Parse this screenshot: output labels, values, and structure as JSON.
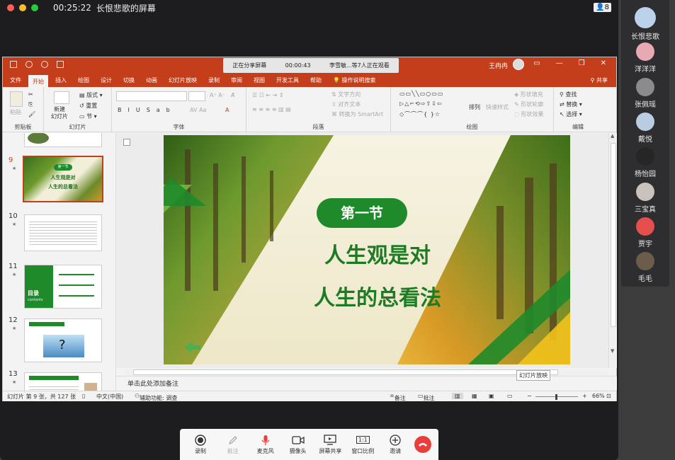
{
  "meeting": {
    "elapsed": "00:25:22",
    "window_title": "长恨悲歌的屏幕",
    "participant_count": "8"
  },
  "participants": [
    {
      "name": "长恨悲歌",
      "color": "#bcd2ea"
    },
    {
      "name": "洋洋洋",
      "color": "#e7a9b3"
    },
    {
      "name": "张佩瑶",
      "color": "#8b8a8c"
    },
    {
      "name": "戴悦",
      "color": "#b9cde2"
    },
    {
      "name": "杨怡园",
      "color": "#262626"
    },
    {
      "name": "三宝真",
      "color": "#c9c2bb"
    },
    {
      "name": "贾宇",
      "color": "#e44f4d"
    },
    {
      "name": "毛毛",
      "color": "#6b5c4c"
    }
  ],
  "share_banner": {
    "status": "正在分享屏幕",
    "timer": "00:00:43",
    "viewers": "李雪敏...等7人正在观看"
  },
  "ppt": {
    "user_name": "王冉冉",
    "share_label": "共享",
    "tabs": [
      "文件",
      "开始",
      "插入",
      "绘图",
      "设计",
      "切换",
      "动画",
      "幻灯片放映",
      "录制",
      "审阅",
      "视图",
      "开发工具",
      "帮助",
      "操作说明搜索"
    ],
    "active_tab": "开始",
    "ribbon": {
      "clipboard": {
        "label": "剪贴板",
        "paste": "粘贴"
      },
      "slides": {
        "label": "幻灯片",
        "new_slide": "新建\n幻灯片",
        "layout": "版式",
        "reset": "重置",
        "section": "节"
      },
      "font": {
        "label": "字体"
      },
      "paragraph": {
        "label": "段落",
        "text_direction": "文字方向",
        "align_text": "对齐文本",
        "smartart": "转换为 SmartArt"
      },
      "drawing": {
        "label": "绘图",
        "arrange": "排列",
        "quick_styles": "快速样式",
        "fill": "形状填充",
        "outline": "形状轮廓",
        "effects": "形状效果"
      },
      "editing": {
        "label": "编辑",
        "find": "查找",
        "replace": "替换",
        "select": "选择"
      }
    },
    "thumbnails": [
      {
        "num": "9",
        "selected": true,
        "title": "第一节",
        "line1": "人生观是对",
        "line2": "人生的总看法"
      },
      {
        "num": "10",
        "selected": false
      },
      {
        "num": "11",
        "selected": false,
        "label": "目录",
        "sub": "contents"
      },
      {
        "num": "12",
        "selected": false
      },
      {
        "num": "13",
        "selected": false
      }
    ],
    "slide": {
      "section": "第一节",
      "line1": "人生观是对",
      "line2": "人生的总看法"
    },
    "notes_placeholder": "单击此处添加备注",
    "slideshow_tooltip": "幻灯片放映",
    "status": {
      "slide_info": "幻灯片 第 9 张，共 127 张",
      "language": "中文(中国)",
      "accessibility": "辅助功能: 调查",
      "notes": "备注",
      "comments": "批注",
      "zoom": "66%"
    }
  },
  "toolbar": [
    {
      "label": "录制",
      "icon": "record-icon",
      "enabled": true
    },
    {
      "label": "批注",
      "icon": "pen-icon",
      "enabled": false
    },
    {
      "label": "麦克风",
      "icon": "microphone-icon",
      "enabled": true
    },
    {
      "label": "摄像头",
      "icon": "camera-icon",
      "enabled": true
    },
    {
      "label": "屏幕共享",
      "icon": "screen-share-icon",
      "enabled": true
    },
    {
      "label": "窗口比例",
      "icon": "ratio-icon",
      "enabled": true,
      "glyph": "1:1"
    },
    {
      "label": "邀请",
      "icon": "invite-icon",
      "enabled": true
    }
  ],
  "colors": {
    "ppt_accent": "#c43e1c",
    "slide_green": "#1f8a2a",
    "hangup": "#e93f3b"
  }
}
